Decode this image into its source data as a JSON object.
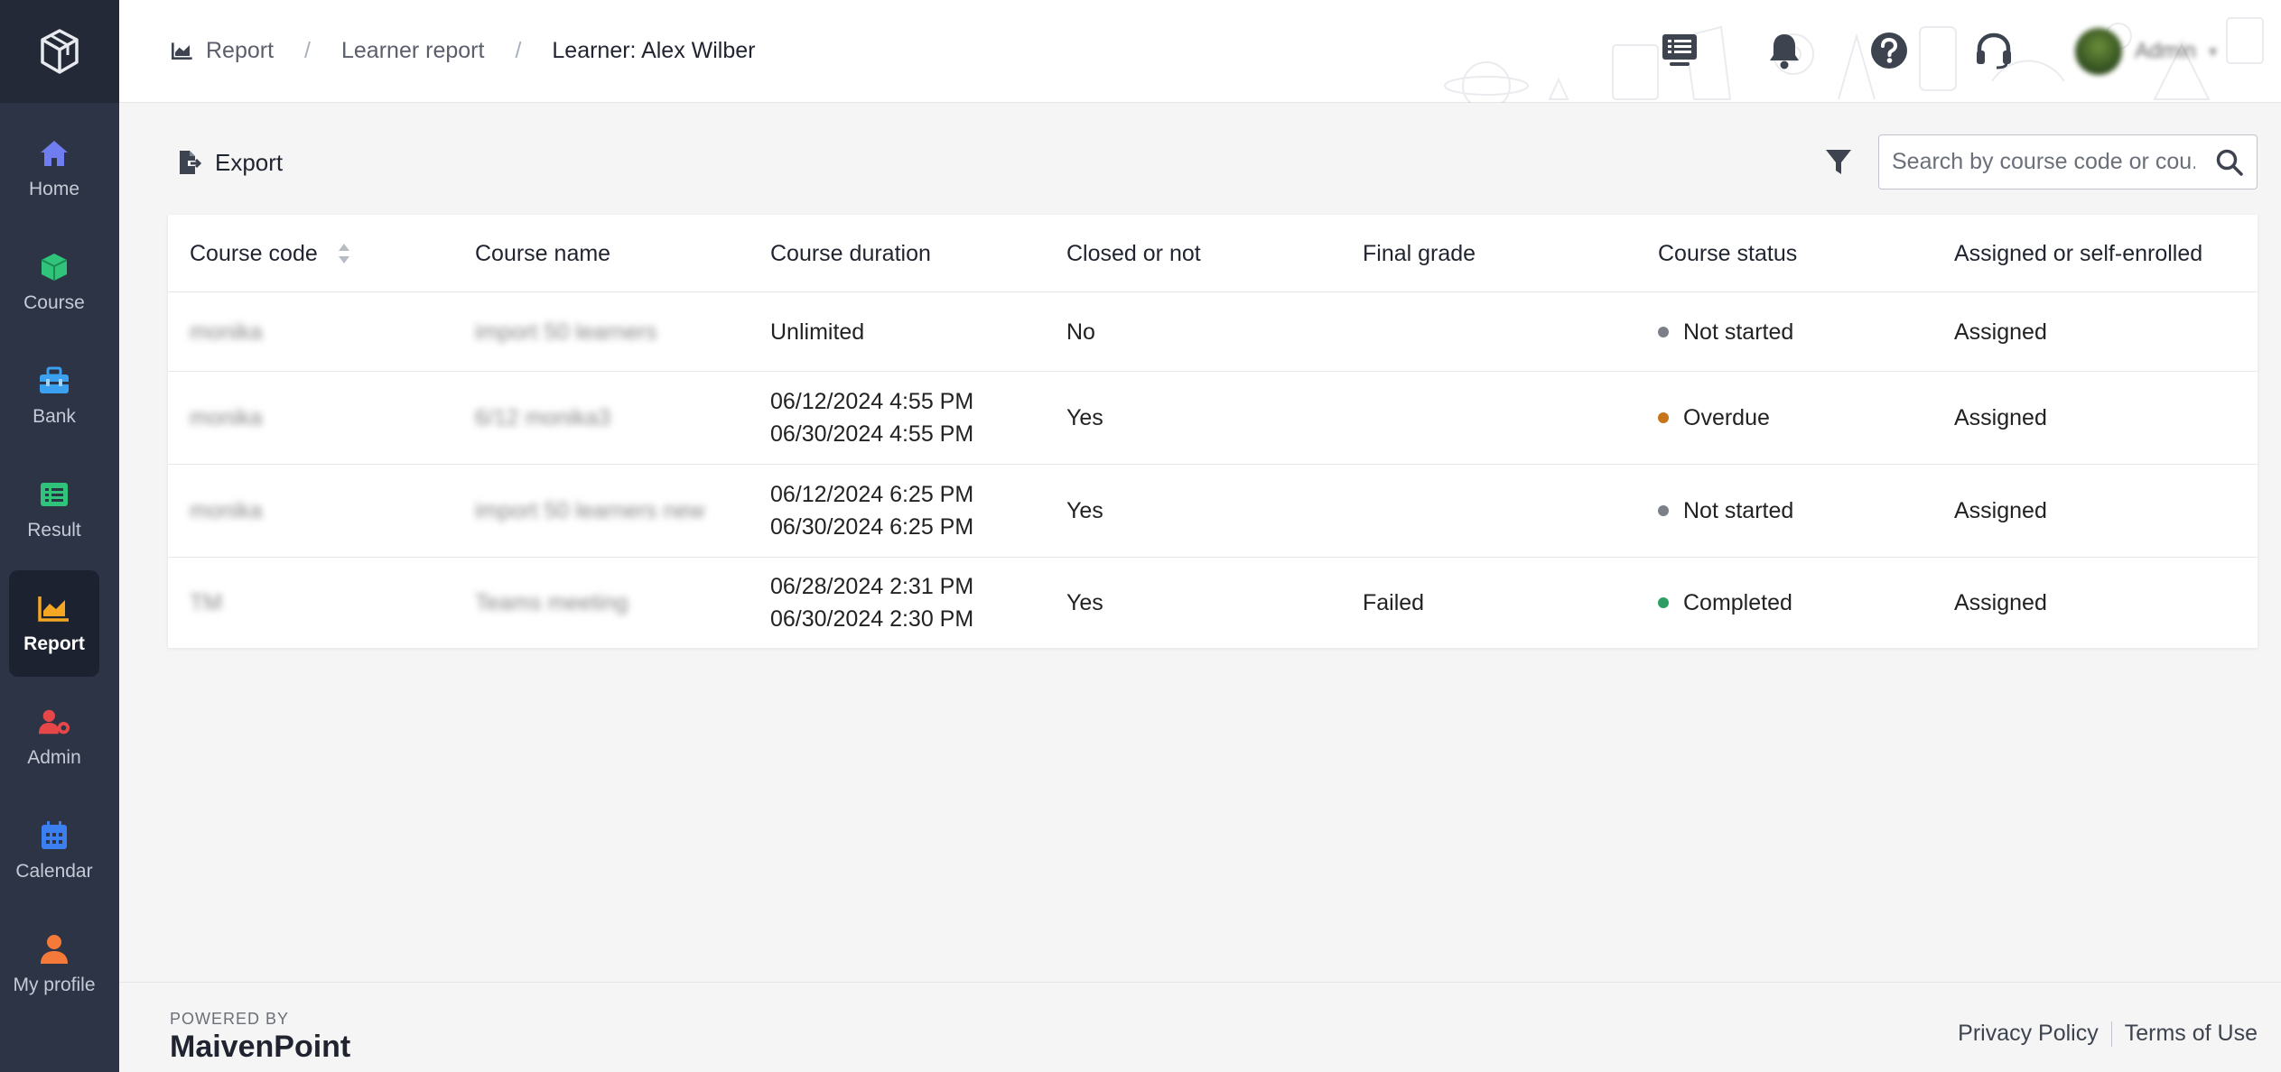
{
  "sidebar": {
    "items": [
      {
        "label": "Home",
        "icon": "home-icon"
      },
      {
        "label": "Course",
        "icon": "cube-icon"
      },
      {
        "label": "Bank",
        "icon": "bank-icon"
      },
      {
        "label": "Result",
        "icon": "list-icon"
      },
      {
        "label": "Report",
        "icon": "chart-icon"
      },
      {
        "label": "Admin",
        "icon": "admin-gear-icon"
      },
      {
        "label": "Calendar",
        "icon": "calendar-icon"
      },
      {
        "label": "My profile",
        "icon": "user-icon"
      }
    ],
    "active": "Report"
  },
  "breadcrumb": {
    "report": "Report",
    "learner_report": "Learner report",
    "current": "Learner: Alex Wilber"
  },
  "header": {
    "user_name": "Admin"
  },
  "toolbar": {
    "export_label": "Export",
    "search_placeholder": "Search by course code or cou..."
  },
  "table": {
    "columns": [
      "Course code",
      "Course name",
      "Course duration",
      "Closed or not",
      "Final grade",
      "Course status",
      "Assigned or self-enrolled"
    ],
    "rows": [
      {
        "code": "monika",
        "name": "import 50 learners",
        "duration1": "Unlimited",
        "duration2": "",
        "closed": "No",
        "grade": "",
        "status": "Not started",
        "status_color": "#7a7f88",
        "assigned": "Assigned"
      },
      {
        "code": "monika",
        "name": "6/12 monika3",
        "duration1": "06/12/2024 4:55 PM",
        "duration2": "06/30/2024 4:55 PM",
        "closed": "Yes",
        "grade": "",
        "status": "Overdue",
        "status_color": "#c8741a",
        "assigned": "Assigned"
      },
      {
        "code": "monika",
        "name": "import 50 learners new",
        "duration1": "06/12/2024 6:25 PM",
        "duration2": "06/30/2024 6:25 PM",
        "closed": "Yes",
        "grade": "",
        "status": "Not started",
        "status_color": "#7a7f88",
        "assigned": "Assigned"
      },
      {
        "code": "TM",
        "name": "Teams meeting",
        "duration1": "06/28/2024 2:31 PM",
        "duration2": "06/30/2024 2:30 PM",
        "closed": "Yes",
        "grade": "Failed",
        "status": "Completed",
        "status_color": "#2e9e62",
        "assigned": "Assigned"
      }
    ]
  },
  "footer": {
    "powered_by": "POWERED BY",
    "brand": "MaivenPoint",
    "privacy": "Privacy Policy",
    "terms": "Terms of Use"
  }
}
